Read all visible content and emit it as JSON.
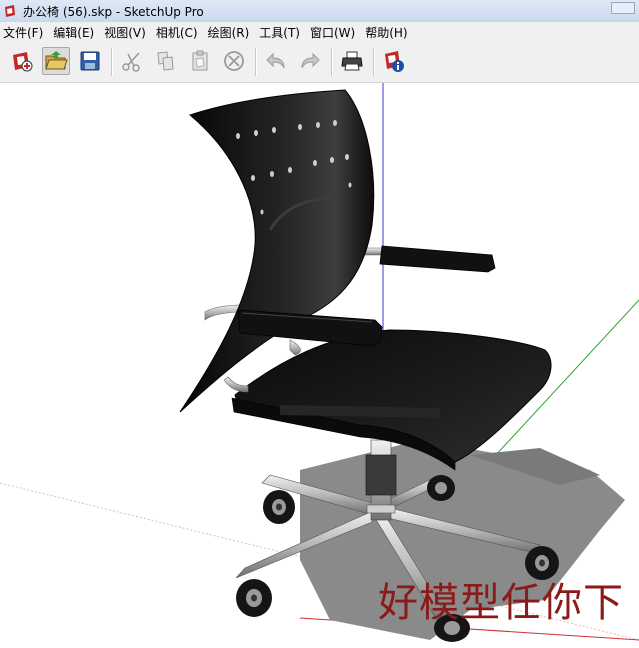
{
  "window": {
    "title": "办公椅 (56).skp - SketchUp Pro"
  },
  "menubar": {
    "items": [
      {
        "label": "文件(F)"
      },
      {
        "label": "编辑(E)"
      },
      {
        "label": "视图(V)"
      },
      {
        "label": "相机(C)"
      },
      {
        "label": "绘图(R)"
      },
      {
        "label": "工具(T)"
      },
      {
        "label": "窗口(W)"
      },
      {
        "label": "帮助(H)"
      }
    ]
  },
  "toolbar": {
    "buttons": [
      {
        "icon": "new-file-icon"
      },
      {
        "icon": "open-folder-icon",
        "active": true
      },
      {
        "icon": "save-icon"
      },
      {
        "icon": "cut-icon"
      },
      {
        "icon": "copy-icon"
      },
      {
        "icon": "paste-icon"
      },
      {
        "icon": "erase-icon"
      },
      {
        "icon": "undo-icon"
      },
      {
        "icon": "redo-icon"
      },
      {
        "icon": "print-icon"
      },
      {
        "icon": "model-info-icon"
      }
    ]
  },
  "viewport": {
    "watermark": "好模型任你下"
  },
  "colors": {
    "axis_green": "#2fa52f",
    "axis_blue": "#3a3ad8",
    "axis_red": "#d03030",
    "watermark": "#8b1a1a"
  }
}
